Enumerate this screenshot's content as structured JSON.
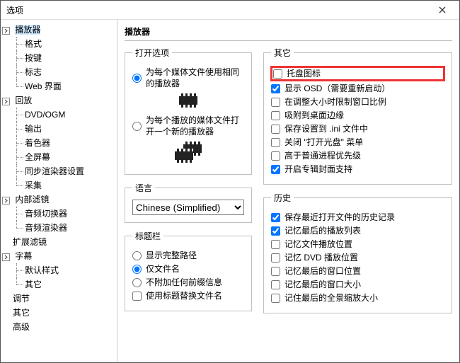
{
  "window": {
    "title": "选项"
  },
  "tree": {
    "player": {
      "label": "播放器",
      "expanded": true,
      "children": {
        "format": "格式",
        "buttons": "按键",
        "logo": "标志",
        "web": "Web 界面"
      }
    },
    "playback": {
      "label": "回放",
      "expanded": true,
      "children": {
        "dvdogm": "DVD/OGM",
        "output": "输出",
        "shader": "着色器",
        "fullscreen": "全屏幕",
        "syncren": "同步渲染器设置",
        "capture": "采集"
      }
    },
    "intf": {
      "label": "内部滤镜",
      "expanded": true,
      "children": {
        "asw": "音频切换器",
        "ar": "音频渲染器"
      }
    },
    "extf": {
      "label": "扩展滤镜"
    },
    "subs": {
      "label": "字幕",
      "expanded": true,
      "children": {
        "defstyle": "默认样式",
        "other": "其它"
      }
    },
    "tune": {
      "label": "调节"
    },
    "misc": {
      "label": "其它"
    },
    "adv": {
      "label": "高级"
    }
  },
  "panel": {
    "title": "播放器",
    "open_group": {
      "legend": "打开选项",
      "same": "为每个媒体文件使用相同的播放器",
      "new": "为每个播放的媒体文件打开一个新的播放器",
      "selected": "same"
    },
    "lang_group": {
      "legend": "语言",
      "value": "Chinese (Simplified)"
    },
    "titlebar_group": {
      "legend": "标题栏",
      "fullpath": "显示完整路径",
      "fileonly": "仅文件名",
      "noprefix": "不附加任何前缀信息",
      "title_sub": "使用标题替换文件名",
      "selected": "fileonly",
      "title_sub_checked": false
    },
    "misc_group": {
      "legend": "其它",
      "items": {
        "tray": {
          "label": "托盘图标",
          "checked": false,
          "highlight": true
        },
        "osd": {
          "label": "显示 OSD（需要重新启动）",
          "checked": true
        },
        "ratio": {
          "label": "在调整大小时限制窗口比例",
          "checked": false
        },
        "snap": {
          "label": "吸附到桌面边缘",
          "checked": false
        },
        "ini": {
          "label": "保存设置到 .ini 文件中",
          "checked": false
        },
        "autoplay": {
          "label": "关闭 \"打开光盘\" 菜单",
          "checked": false
        },
        "prio": {
          "label": "高于普通进程优先级",
          "checked": false
        },
        "cover": {
          "label": "开启专辑封面支持",
          "checked": true
        }
      }
    },
    "history_group": {
      "legend": "历史",
      "items": {
        "recent": {
          "label": "保存最近打开文件的历史记录",
          "checked": true
        },
        "playlist": {
          "label": "记忆最后的播放列表",
          "checked": true
        },
        "filepos": {
          "label": "记忆文件播放位置",
          "checked": false
        },
        "dvdpos": {
          "label": "记忆 DVD 播放位置",
          "checked": false
        },
        "winpos": {
          "label": "记忆最后的窗口位置",
          "checked": false
        },
        "winsize": {
          "label": "记忆最后的窗口大小",
          "checked": false
        },
        "panzoom": {
          "label": "记住最后的全景缩放大小",
          "checked": false
        }
      }
    }
  }
}
